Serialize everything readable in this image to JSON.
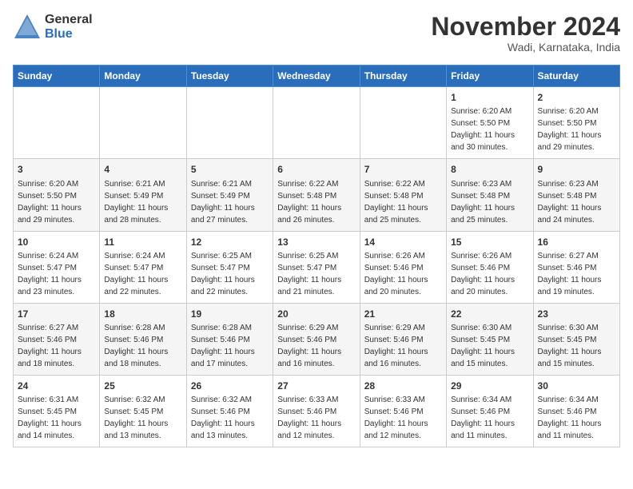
{
  "logo": {
    "general": "General",
    "blue": "Blue"
  },
  "title": "November 2024",
  "location": "Wadi, Karnataka, India",
  "days_of_week": [
    "Sunday",
    "Monday",
    "Tuesday",
    "Wednesday",
    "Thursday",
    "Friday",
    "Saturday"
  ],
  "weeks": [
    [
      {
        "day": "",
        "info": ""
      },
      {
        "day": "",
        "info": ""
      },
      {
        "day": "",
        "info": ""
      },
      {
        "day": "",
        "info": ""
      },
      {
        "day": "",
        "info": ""
      },
      {
        "day": "1",
        "info": "Sunrise: 6:20 AM\nSunset: 5:50 PM\nDaylight: 11 hours and 30 minutes."
      },
      {
        "day": "2",
        "info": "Sunrise: 6:20 AM\nSunset: 5:50 PM\nDaylight: 11 hours and 29 minutes."
      }
    ],
    [
      {
        "day": "3",
        "info": "Sunrise: 6:20 AM\nSunset: 5:50 PM\nDaylight: 11 hours and 29 minutes."
      },
      {
        "day": "4",
        "info": "Sunrise: 6:21 AM\nSunset: 5:49 PM\nDaylight: 11 hours and 28 minutes."
      },
      {
        "day": "5",
        "info": "Sunrise: 6:21 AM\nSunset: 5:49 PM\nDaylight: 11 hours and 27 minutes."
      },
      {
        "day": "6",
        "info": "Sunrise: 6:22 AM\nSunset: 5:48 PM\nDaylight: 11 hours and 26 minutes."
      },
      {
        "day": "7",
        "info": "Sunrise: 6:22 AM\nSunset: 5:48 PM\nDaylight: 11 hours and 25 minutes."
      },
      {
        "day": "8",
        "info": "Sunrise: 6:23 AM\nSunset: 5:48 PM\nDaylight: 11 hours and 25 minutes."
      },
      {
        "day": "9",
        "info": "Sunrise: 6:23 AM\nSunset: 5:48 PM\nDaylight: 11 hours and 24 minutes."
      }
    ],
    [
      {
        "day": "10",
        "info": "Sunrise: 6:24 AM\nSunset: 5:47 PM\nDaylight: 11 hours and 23 minutes."
      },
      {
        "day": "11",
        "info": "Sunrise: 6:24 AM\nSunset: 5:47 PM\nDaylight: 11 hours and 22 minutes."
      },
      {
        "day": "12",
        "info": "Sunrise: 6:25 AM\nSunset: 5:47 PM\nDaylight: 11 hours and 22 minutes."
      },
      {
        "day": "13",
        "info": "Sunrise: 6:25 AM\nSunset: 5:47 PM\nDaylight: 11 hours and 21 minutes."
      },
      {
        "day": "14",
        "info": "Sunrise: 6:26 AM\nSunset: 5:46 PM\nDaylight: 11 hours and 20 minutes."
      },
      {
        "day": "15",
        "info": "Sunrise: 6:26 AM\nSunset: 5:46 PM\nDaylight: 11 hours and 20 minutes."
      },
      {
        "day": "16",
        "info": "Sunrise: 6:27 AM\nSunset: 5:46 PM\nDaylight: 11 hours and 19 minutes."
      }
    ],
    [
      {
        "day": "17",
        "info": "Sunrise: 6:27 AM\nSunset: 5:46 PM\nDaylight: 11 hours and 18 minutes."
      },
      {
        "day": "18",
        "info": "Sunrise: 6:28 AM\nSunset: 5:46 PM\nDaylight: 11 hours and 18 minutes."
      },
      {
        "day": "19",
        "info": "Sunrise: 6:28 AM\nSunset: 5:46 PM\nDaylight: 11 hours and 17 minutes."
      },
      {
        "day": "20",
        "info": "Sunrise: 6:29 AM\nSunset: 5:46 PM\nDaylight: 11 hours and 16 minutes."
      },
      {
        "day": "21",
        "info": "Sunrise: 6:29 AM\nSunset: 5:46 PM\nDaylight: 11 hours and 16 minutes."
      },
      {
        "day": "22",
        "info": "Sunrise: 6:30 AM\nSunset: 5:45 PM\nDaylight: 11 hours and 15 minutes."
      },
      {
        "day": "23",
        "info": "Sunrise: 6:30 AM\nSunset: 5:45 PM\nDaylight: 11 hours and 15 minutes."
      }
    ],
    [
      {
        "day": "24",
        "info": "Sunrise: 6:31 AM\nSunset: 5:45 PM\nDaylight: 11 hours and 14 minutes."
      },
      {
        "day": "25",
        "info": "Sunrise: 6:32 AM\nSunset: 5:45 PM\nDaylight: 11 hours and 13 minutes."
      },
      {
        "day": "26",
        "info": "Sunrise: 6:32 AM\nSunset: 5:46 PM\nDaylight: 11 hours and 13 minutes."
      },
      {
        "day": "27",
        "info": "Sunrise: 6:33 AM\nSunset: 5:46 PM\nDaylight: 11 hours and 12 minutes."
      },
      {
        "day": "28",
        "info": "Sunrise: 6:33 AM\nSunset: 5:46 PM\nDaylight: 11 hours and 12 minutes."
      },
      {
        "day": "29",
        "info": "Sunrise: 6:34 AM\nSunset: 5:46 PM\nDaylight: 11 hours and 11 minutes."
      },
      {
        "day": "30",
        "info": "Sunrise: 6:34 AM\nSunset: 5:46 PM\nDaylight: 11 hours and 11 minutes."
      }
    ]
  ]
}
